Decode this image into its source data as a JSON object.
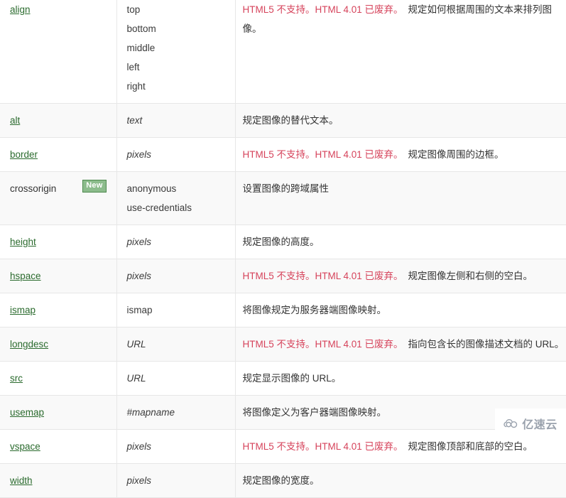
{
  "table": {
    "rows": [
      {
        "attr": "align",
        "is_link": true,
        "badge": null,
        "values": [
          "top",
          "bottom",
          "middle",
          "left",
          "right"
        ],
        "values_italic": false,
        "deprecated": "HTML5 不支持。HTML 4.01 已废弃。",
        "description": "规定如何根据周围的文本来排列图像。"
      },
      {
        "attr": "alt",
        "is_link": true,
        "badge": null,
        "values": [
          "text"
        ],
        "values_italic": true,
        "deprecated": "",
        "description": "规定图像的替代文本。"
      },
      {
        "attr": "border",
        "is_link": true,
        "badge": null,
        "values": [
          "pixels"
        ],
        "values_italic": true,
        "deprecated": "HTML5 不支持。HTML 4.01 已废弃。",
        "description": "规定图像周围的边框。"
      },
      {
        "attr": "crossorigin",
        "is_link": false,
        "badge": "New",
        "values": [
          "anonymous",
          "use-credentials"
        ],
        "values_italic": false,
        "deprecated": "",
        "description": "设置图像的跨域属性"
      },
      {
        "attr": "height",
        "is_link": true,
        "badge": null,
        "values": [
          "pixels"
        ],
        "values_italic": true,
        "deprecated": "",
        "description": "规定图像的高度。"
      },
      {
        "attr": "hspace",
        "is_link": true,
        "badge": null,
        "values": [
          "pixels"
        ],
        "values_italic": true,
        "deprecated": "HTML5 不支持。HTML 4.01 已废弃。",
        "description": "规定图像左侧和右侧的空白。"
      },
      {
        "attr": "ismap",
        "is_link": true,
        "badge": null,
        "values": [
          "ismap"
        ],
        "values_italic": false,
        "deprecated": "",
        "description": "将图像规定为服务器端图像映射。"
      },
      {
        "attr": "longdesc",
        "is_link": true,
        "badge": null,
        "values": [
          "URL"
        ],
        "values_italic": true,
        "deprecated": "HTML5 不支持。HTML 4.01 已废弃。",
        "description": "指向包含长的图像描述文档的 URL。"
      },
      {
        "attr": "src",
        "is_link": true,
        "badge": null,
        "values": [
          "URL"
        ],
        "values_italic": true,
        "deprecated": "",
        "description": "规定显示图像的 URL。"
      },
      {
        "attr": "usemap",
        "is_link": true,
        "badge": null,
        "values": [
          "#mapname"
        ],
        "values_italic": true,
        "deprecated": "",
        "description": "将图像定义为客户器端图像映射。"
      },
      {
        "attr": "vspace",
        "is_link": true,
        "badge": null,
        "values": [
          "pixels"
        ],
        "values_italic": true,
        "deprecated": "HTML5 不支持。HTML 4.01 已废弃。",
        "description": "规定图像顶部和底部的空白。"
      },
      {
        "attr": "width",
        "is_link": true,
        "badge": null,
        "values": [
          "pixels"
        ],
        "values_italic": true,
        "deprecated": "",
        "description": "规定图像的宽度。"
      }
    ]
  },
  "watermark": {
    "text": "亿速云",
    "icon": "cloud-icon"
  },
  "colors": {
    "link": "#2b6b2e",
    "deprecated": "#d6435b",
    "badge_bg": "#8cbc8c",
    "badge_border": "#4e8a4e",
    "row_alt_bg": "#f9f9f9",
    "border": "#e7e7e7",
    "text": "#333333",
    "watermark": "#9aa2ad"
  }
}
